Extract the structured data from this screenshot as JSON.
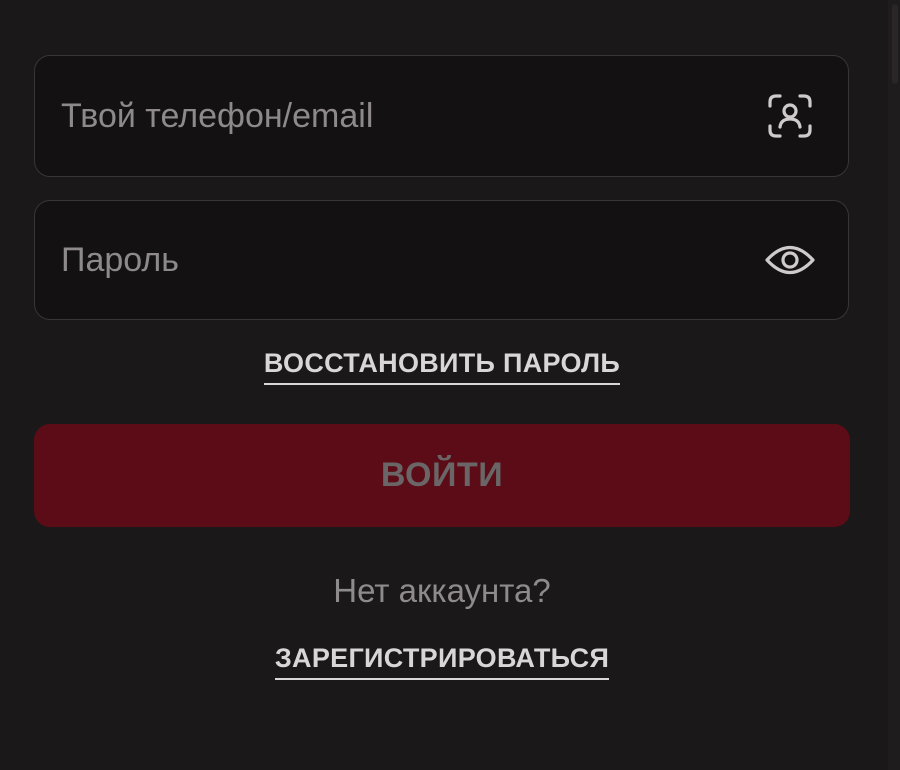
{
  "login_form": {
    "login_field": {
      "placeholder": "Твой телефон/email",
      "value": "",
      "icon": "face-id-icon"
    },
    "password_field": {
      "placeholder": "Пароль",
      "value": "",
      "icon": "eye-icon"
    },
    "restore_password_label": "ВОССТАНОВИТЬ ПАРОЛЬ",
    "submit_label": "ВОЙТИ",
    "no_account_text": "Нет аккаунта?",
    "register_label": "ЗАРЕГИСТРИРОВАТЬСЯ"
  },
  "colors": {
    "background": "#1b1819",
    "field_background": "#141112",
    "field_border": "#3a3537",
    "submit_background": "#5c0c16",
    "submit_text_disabled": "#6a6566",
    "link_text": "#d9d6d7",
    "muted_text": "#8f8b8c"
  }
}
